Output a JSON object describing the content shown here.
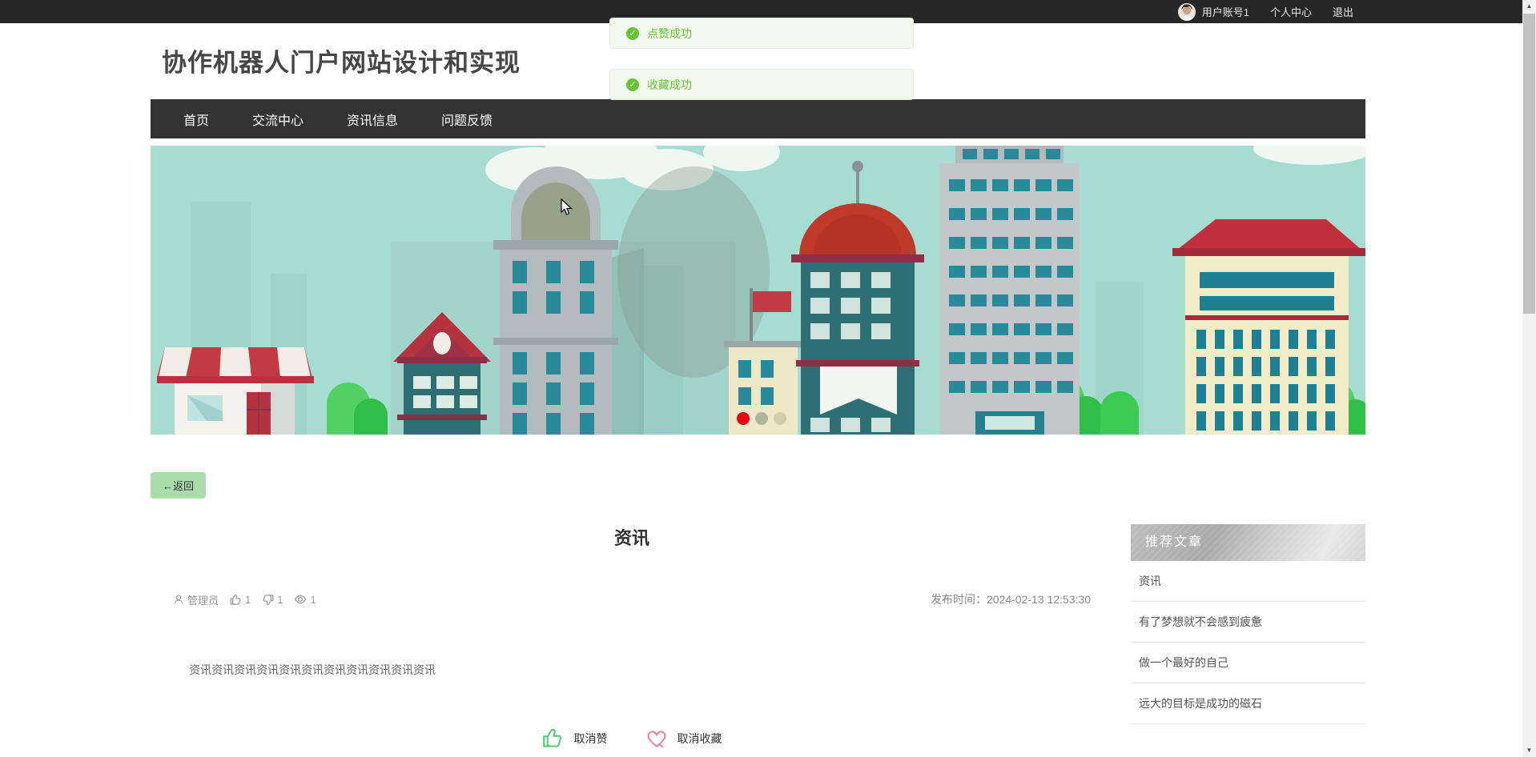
{
  "topbar": {
    "username": "用户账号1",
    "profile_label": "个人中心",
    "logout_label": "退出"
  },
  "toasts": [
    {
      "icon": "check-circle",
      "text": "点赞成功"
    },
    {
      "icon": "check-circle",
      "text": "收藏成功"
    }
  ],
  "site": {
    "title": "协作机器人门户网站设计和实现"
  },
  "nav": {
    "items": [
      {
        "label": "首页"
      },
      {
        "label": "交流中心"
      },
      {
        "label": "资讯信息"
      },
      {
        "label": "问题反馈"
      }
    ]
  },
  "carousel": {
    "dot_count": 3,
    "active_index": 0
  },
  "back_button": {
    "label": "←返回"
  },
  "article": {
    "title": "资讯",
    "author": "管理员",
    "likes": "1",
    "dislikes": "1",
    "views": "1",
    "publish_label": "发布时间：",
    "publish_time": "2024-02-13 12:53:30",
    "content": "资讯资讯资讯资讯资讯资讯资讯资讯资讯资讯资讯",
    "unlike_label": "取消赞",
    "uncollect_label": "取消收藏"
  },
  "sidebar": {
    "title": "推荐文章",
    "items": [
      {
        "label": "资讯"
      },
      {
        "label": "有了梦想就不会感到疲惫"
      },
      {
        "label": "做一个最好的自己"
      },
      {
        "label": "远大的目标是成功的磁石"
      }
    ]
  },
  "colors": {
    "toast_green": "#67c23a",
    "toast_bg": "#f0f9eb",
    "nav_bg": "#333333",
    "topbar_bg": "#272727",
    "banner_sky": "#a7dcd3",
    "active_dot_red": "#e60012",
    "like_icon_green": "#4ecb73",
    "heart_icon_pink": "#ef7d97",
    "back_button_bg": "#abdcad"
  }
}
